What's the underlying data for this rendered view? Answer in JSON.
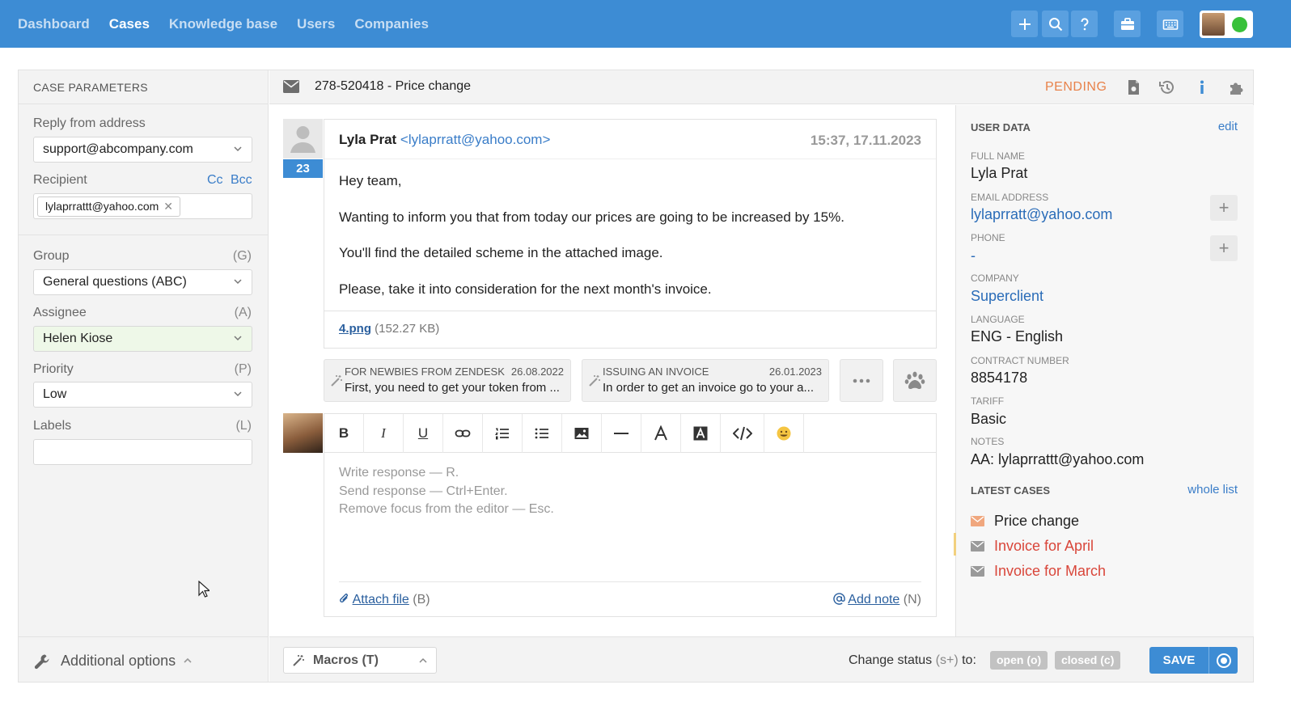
{
  "nav": {
    "items": [
      "Dashboard",
      "Cases",
      "Knowledge base",
      "Users",
      "Companies"
    ],
    "active": 1
  },
  "toolbar": {
    "icons": [
      "plus-icon",
      "search-icon",
      "help-icon",
      "briefcase-icon",
      "keyboard-icon"
    ]
  },
  "left": {
    "header": "CASE PARAMETERS",
    "reply_label": "Reply from address",
    "reply_value": "support@abcompany.com",
    "recipient_label": "Recipient",
    "cc": "Cc",
    "bcc": "Bcc",
    "recipient_chip": "lylaprrattt@yahoo.com",
    "group_label": "Group",
    "group_key": "(G)",
    "group_value": "General questions (ABC)",
    "assignee_label": "Assignee",
    "assignee_key": "(A)",
    "assignee_value": "Helen Kiose",
    "priority_label": "Priority",
    "priority_key": "(P)",
    "priority_value": "Low",
    "labels_label": "Labels",
    "labels_key": "(L)",
    "additional": "Additional options"
  },
  "case": {
    "title": "278-520418 - Price change",
    "status": "PENDING"
  },
  "message": {
    "count": "23",
    "sender_name": "Lyla Prat",
    "sender_email": "<lylaprratt@yahoo.com>",
    "datetime": "15:37, 17.11.2023",
    "lines": [
      "Hey team,",
      "Wanting to inform you that from today our prices are going to be increased by 15%.",
      "You'll find the detailed scheme in the attached image.",
      "Please, take it into consideration for the next month's invoice."
    ],
    "attachment_name": "4.png",
    "attachment_size": "(152.27 KB)"
  },
  "macro_cards": [
    {
      "name": "FOR NEWBIES FROM ZENDESK",
      "date": "26.08.2022",
      "text": "First, you need to get your token from ..."
    },
    {
      "name": "ISSUING AN INVOICE",
      "date": "26.01.2023",
      "text": "In order to get an invoice  go to your a..."
    }
  ],
  "editor": {
    "tool_bold": "B",
    "tool_italic": "I",
    "tool_underline": "U",
    "placeholder_lines": [
      "Write response — R.",
      "Send response — Ctrl+Enter.",
      "Remove focus from the editor — Esc."
    ],
    "attach_label": "Attach file",
    "attach_key": "(B)",
    "note_label": "Add note",
    "note_key": "(N)"
  },
  "footer": {
    "macros": "Macros (T)",
    "change_status": "Change status",
    "change_key": "(s+)",
    "change_to": "to:",
    "open": "open (o)",
    "closed": "closed (c)",
    "save": "SAVE"
  },
  "user": {
    "header": "USER DATA",
    "edit": "edit",
    "fields": [
      {
        "label": "FULL NAME",
        "value": "Lyla Prat"
      },
      {
        "label": "EMAIL ADDRESS",
        "value": "lylaprratt@yahoo.com"
      },
      {
        "label": "PHONE",
        "value": "-"
      },
      {
        "label": "COMPANY",
        "value": "Superclient"
      },
      {
        "label": "LANGUAGE",
        "value": "ENG - English"
      },
      {
        "label": "CONTRACT NUMBER",
        "value": "8854178"
      },
      {
        "label": "TARIFF",
        "value": "Basic"
      },
      {
        "label": "NOTES",
        "value": "AA: lylaprrattt@yahoo.com"
      }
    ],
    "latest_header": "LATEST CASES",
    "whole_list": "whole list",
    "latest": [
      "Price change",
      "Invoice for April",
      "Invoice for March"
    ]
  },
  "colors": {
    "brand": "#3d8cd4",
    "pending": "#e8824a",
    "link": "#3a7dc8",
    "case_red": "#d9463a",
    "online": "#38c13a"
  }
}
